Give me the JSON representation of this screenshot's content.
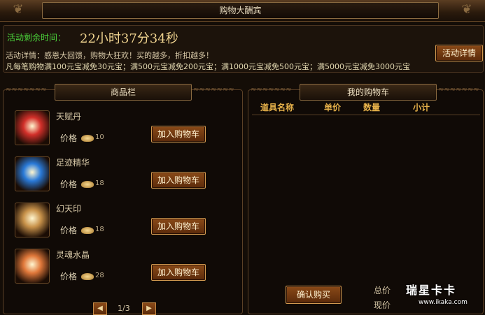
{
  "window": {
    "title": "购物大酬宾"
  },
  "event": {
    "timer_label": "活动剩余时间：",
    "timer_value": "22小时37分34秒",
    "desc_line1": "活动详情：感恩大回馈，购物大狂欢！买的越多，折扣越多！",
    "desc_line2": "凡每笔购物满100元宝减免30元宝；满500元宝减免200元宝；满1000元宝减免500元宝；满5000元宝减免3000元宝",
    "detail_button": "活动详情"
  },
  "shop": {
    "header": "商品栏",
    "price_label": "价格",
    "add_button": "加入购物车",
    "items": [
      {
        "name": "天赋丹",
        "price": "10",
        "color": "#d2302a"
      },
      {
        "name": "足迹精华",
        "price": "18",
        "color": "#2a7ad8"
      },
      {
        "name": "幻天印",
        "price": "18",
        "color": "#c8924a"
      },
      {
        "name": "灵魂水晶",
        "price": "28",
        "color": "#e0783a"
      }
    ],
    "pager": {
      "text": "1/3",
      "prev_icon": "◀",
      "next_icon": "▶"
    }
  },
  "cart": {
    "header": "我的购物车",
    "columns": [
      "道具名称",
      "单价",
      "数量",
      "小计"
    ],
    "confirm_button": "确认购买",
    "total_label": "总价",
    "current_label": "现价"
  },
  "watermark": {
    "main": "瑞星卡卡",
    "sub": "www.ikaka.com"
  },
  "colors": {
    "accent": "#e6b14a",
    "timer_label": "#4ad13a",
    "button": "#8a4a18"
  }
}
